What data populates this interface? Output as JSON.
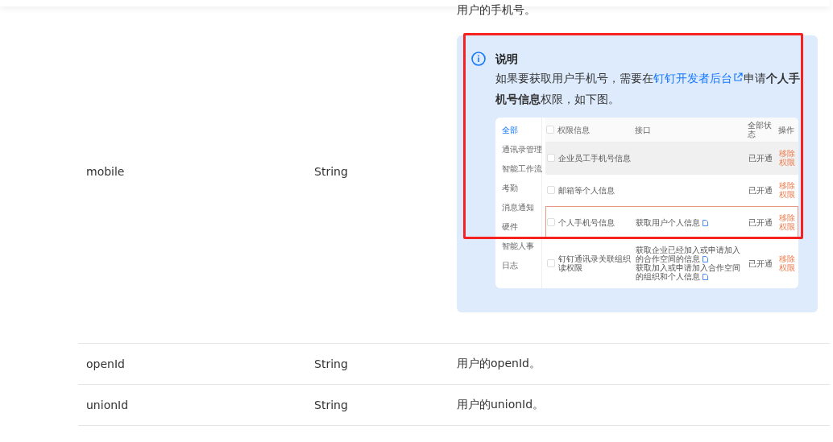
{
  "table": {
    "rows": [
      {
        "name": "mobile",
        "type": "String",
        "description": "用户的手机号。",
        "note": {
          "title": "说明",
          "segments": [
            {
              "kind": "plain",
              "text": "如果要获取用户手机号，需要在"
            },
            {
              "kind": "link",
              "text": "钉钉开发者后台"
            },
            {
              "kind": "plain",
              "text": "申请"
            },
            {
              "kind": "bold",
              "text": "个人手机号信息"
            },
            {
              "kind": "plain",
              "text": "权限，如下图。"
            }
          ],
          "screenshot": {
            "sidebar": [
              {
                "label": "全部",
                "selected": true
              },
              {
                "label": "通讯录管理",
                "selected": false
              },
              {
                "label": "智能工作流",
                "selected": false
              },
              {
                "label": "考勤",
                "selected": false
              },
              {
                "label": "消息通知",
                "selected": false
              },
              {
                "label": "硬件",
                "selected": false
              },
              {
                "label": "智能人事",
                "selected": false
              },
              {
                "label": "日志",
                "selected": false
              }
            ],
            "header_checked": false,
            "columns": [
              "权限信息",
              "接口",
              "全部状态",
              "操作"
            ],
            "rows": [
              {
                "permission": "企业员工手机号信息",
                "apis": [],
                "status": "已开通",
                "action": "移除权限",
                "highlighted": false,
                "shaded": true,
                "checked": false
              },
              {
                "permission": "邮箱等个人信息",
                "apis": [],
                "status": "已开通",
                "action": "移除权限",
                "highlighted": false,
                "shaded": false,
                "checked": false
              },
              {
                "permission": "个人手机号信息",
                "apis": [
                  "获取用户个人信息"
                ],
                "status": "已开通",
                "action": "移除权限",
                "highlighted": true,
                "shaded": false,
                "checked": false
              },
              {
                "permission": "钉钉通讯录关联组织读权限",
                "apis": [
                  "获取企业已经加入或申请加入的合作空间的信息",
                  "获取加入或申请加入合作空间的组织和个人信息"
                ],
                "status": "已开通",
                "action": "移除权限",
                "highlighted": false,
                "shaded": false,
                "checked": false
              }
            ]
          }
        }
      },
      {
        "name": "openId",
        "type": "String",
        "description": "用户的openId。"
      },
      {
        "name": "unionId",
        "type": "String",
        "description": "用户的unionId。"
      }
    ]
  }
}
